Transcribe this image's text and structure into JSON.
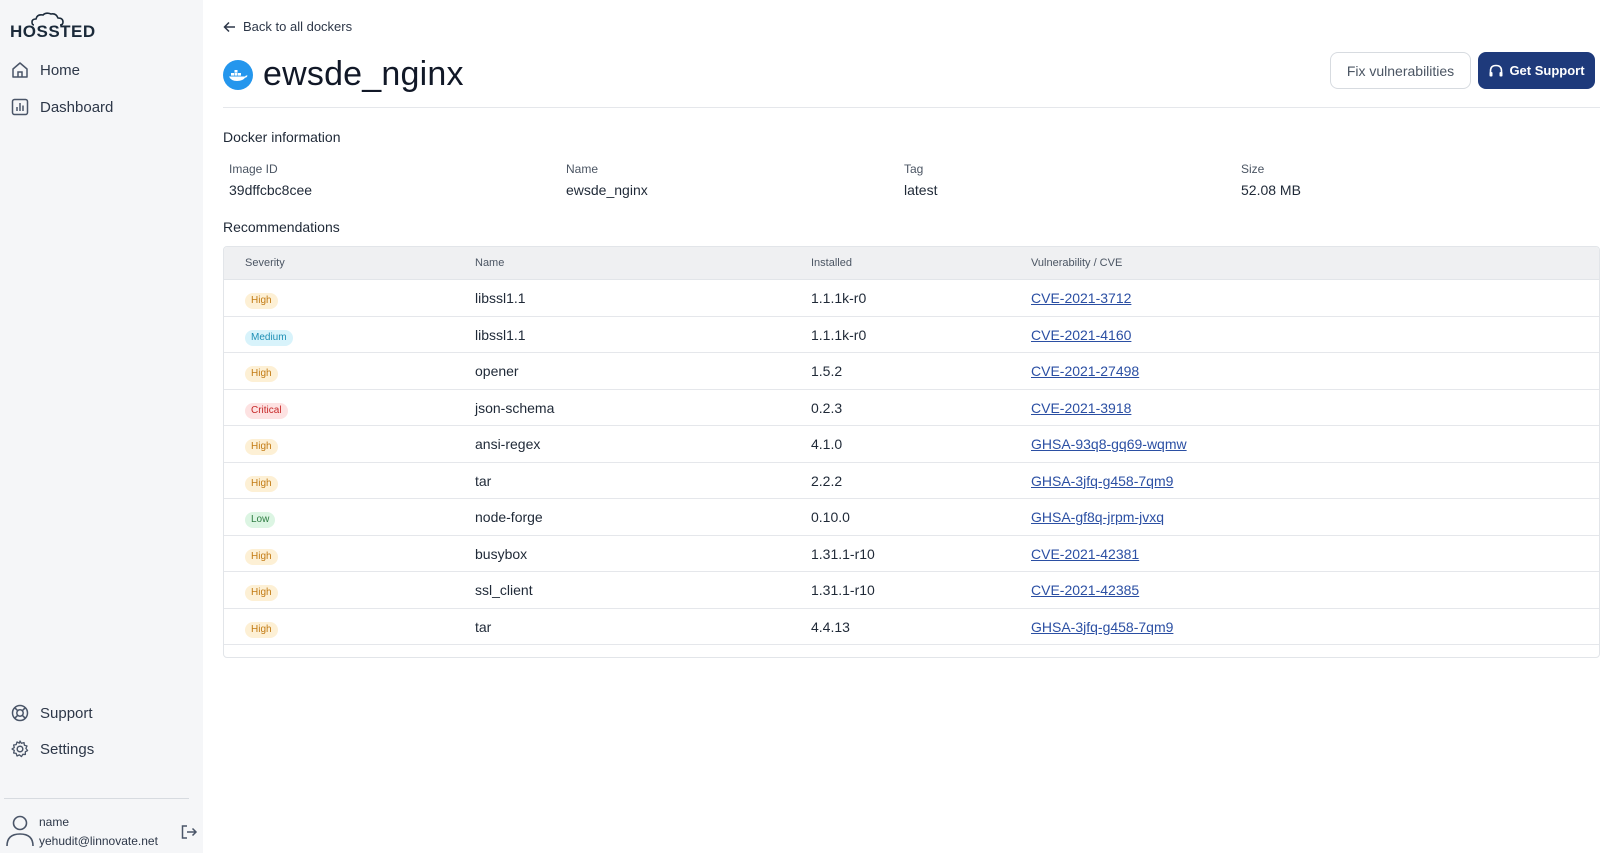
{
  "brand": {
    "name": "HOSSTED"
  },
  "sidebar": {
    "nav": [
      {
        "label": "Home",
        "icon": "home-icon"
      },
      {
        "label": "Dashboard",
        "icon": "dashboard-icon"
      }
    ],
    "bottom": [
      {
        "label": "Support",
        "icon": "lifebuoy-icon"
      },
      {
        "label": "Settings",
        "icon": "gear-icon"
      }
    ],
    "user": {
      "name": "name",
      "email": "yehudit@linnovate.net"
    }
  },
  "header": {
    "back_label": "Back to all dockers",
    "title": "ewsde_nginx",
    "fix_label": "Fix vulnerabilities",
    "support_label": "Get Support"
  },
  "docker_info": {
    "heading": "Docker information",
    "fields": [
      {
        "label": "Image ID",
        "value": "39dffcbc8cee"
      },
      {
        "label": "Name",
        "value": "ewsde_nginx"
      },
      {
        "label": "Tag",
        "value": "latest"
      },
      {
        "label": "Size",
        "value": "52.08 MB"
      }
    ]
  },
  "recommendations": {
    "heading": "Recommendations",
    "columns": [
      "Severity",
      "Name",
      "Installed",
      "Vulnerability / CVE"
    ],
    "rows": [
      {
        "severity": "High",
        "name": "libssl1.1",
        "installed": "1.1.1k-r0",
        "cve": "CVE-2021-3712"
      },
      {
        "severity": "Medium",
        "name": "libssl1.1",
        "installed": "1.1.1k-r0",
        "cve": "CVE-2021-4160"
      },
      {
        "severity": "High",
        "name": "opener",
        "installed": "1.5.2",
        "cve": "CVE-2021-27498"
      },
      {
        "severity": "Critical",
        "name": "json-schema",
        "installed": "0.2.3",
        "cve": "CVE-2021-3918"
      },
      {
        "severity": "High",
        "name": "ansi-regex",
        "installed": "4.1.0",
        "cve": "GHSA-93q8-gq69-wqmw"
      },
      {
        "severity": "High",
        "name": "tar",
        "installed": "2.2.2",
        "cve": "GHSA-3jfq-g458-7qm9"
      },
      {
        "severity": "Low",
        "name": "node-forge",
        "installed": "0.10.0",
        "cve": "GHSA-gf8q-jrpm-jvxq"
      },
      {
        "severity": "High",
        "name": "busybox",
        "installed": "1.31.1-r10",
        "cve": "CVE-2021-42381"
      },
      {
        "severity": "High",
        "name": "ssl_client",
        "installed": "1.31.1-r10",
        "cve": "CVE-2021-42385"
      },
      {
        "severity": "High",
        "name": "tar",
        "installed": "4.4.13",
        "cve": "GHSA-3jfq-g458-7qm9"
      }
    ],
    "severity_colors": {
      "High": {
        "bg": "#fdf0d5",
        "fg": "#c27a12"
      },
      "Medium": {
        "bg": "#d8f3fb",
        "fg": "#1e8fb5"
      },
      "Critical": {
        "bg": "#fde2e2",
        "fg": "#c62828"
      },
      "Low": {
        "bg": "#dcf5e3",
        "fg": "#2e7d42"
      }
    }
  },
  "colors": {
    "primary": "#1e3a7b",
    "link": "#2b4fa3",
    "docker": "#2496ed"
  }
}
